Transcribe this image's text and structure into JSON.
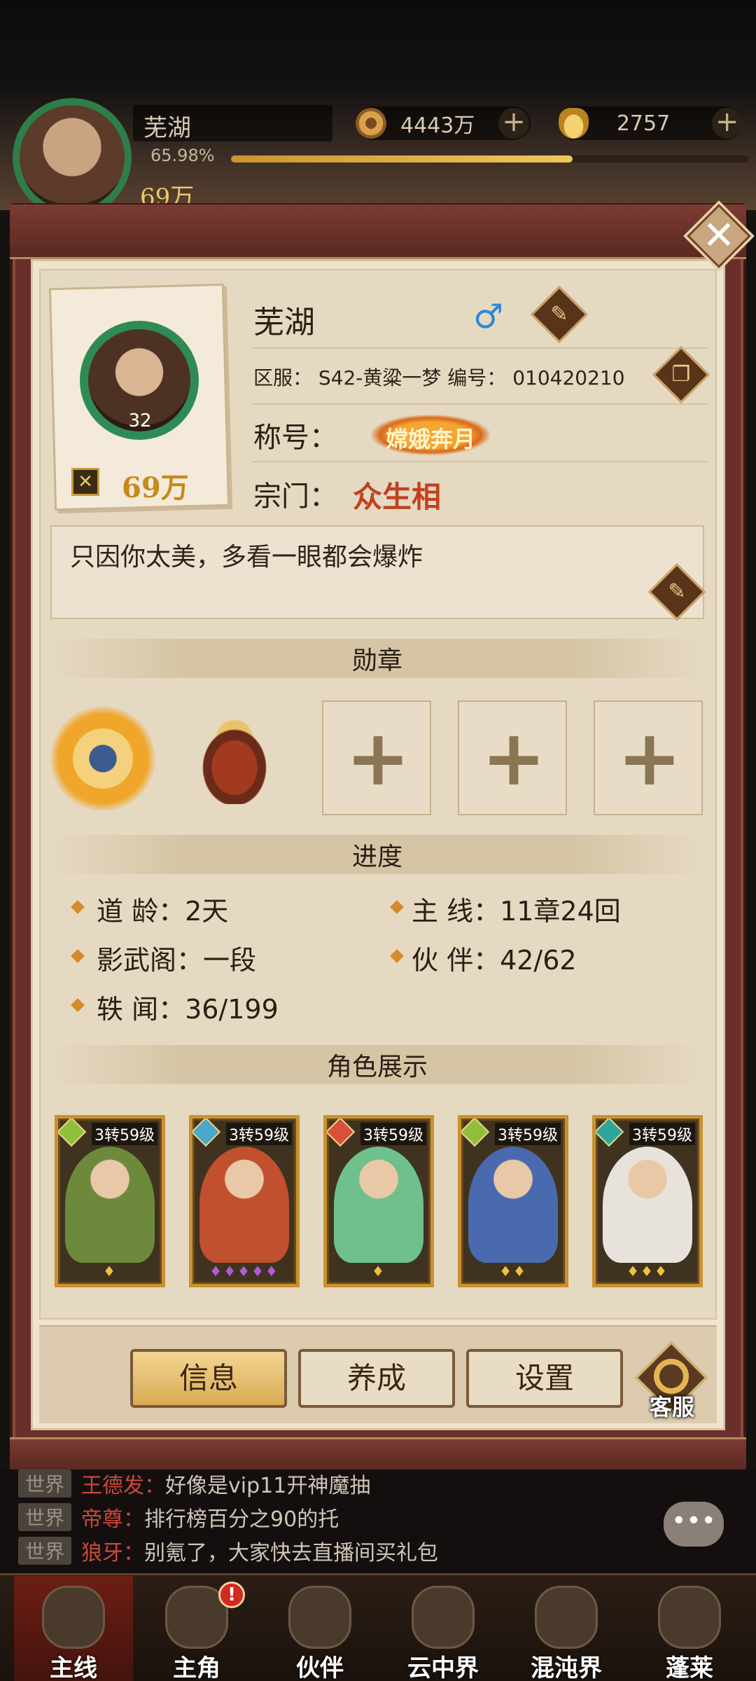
{
  "hud": {
    "name": "芜湖",
    "exp_percent_text": "65.98%",
    "exp_fraction": 0.6598,
    "power": "69万",
    "coins": "4443万",
    "ingots": "2757",
    "plus": "+"
  },
  "profile": {
    "name": "芜湖",
    "gender_symbol": "♂",
    "server": "区服：  S42-黄粱一梦 编号：  010420210",
    "title_label": "称号：",
    "title_badge": "嫦娥奔月",
    "sect_label": "宗门：",
    "sect": "众生相",
    "level": "32",
    "power": "69万",
    "signature": "只因你太美，多看一眼都会爆炸"
  },
  "sections": {
    "medals": "勋章",
    "progress": "进度",
    "characters": "角色展示"
  },
  "medal_slots": [
    "+",
    "+",
    "+"
  ],
  "progress": [
    {
      "text": "道   龄：2天"
    },
    {
      "text": "主   线：11章24回"
    },
    {
      "text": "影武阁：一段"
    },
    {
      "text": "伙   伴：42/62"
    },
    {
      "text": "轶   闻：36/199"
    }
  ],
  "characters": [
    {
      "level": "3转59级",
      "gem_color": "#8fbf3a",
      "art_color": "#6d8a3c",
      "stars": "♦",
      "star_color": "#f0c040"
    },
    {
      "level": "3转59级",
      "gem_color": "#4aa8c8",
      "art_color": "#c0502e",
      "stars": "♦♦♦♦♦",
      "star_color": "#b25ad8"
    },
    {
      "level": "3转59级",
      "gem_color": "#d8503a",
      "art_color": "#6fc08a",
      "stars": "♦",
      "star_color": "#f0c040"
    },
    {
      "level": "3转59级",
      "gem_color": "#8fbf3a",
      "art_color": "#4a6ab0",
      "stars": "♦♦",
      "star_color": "#f0c040"
    },
    {
      "level": "3转59级",
      "gem_color": "#2aa89a",
      "art_color": "#e8e2dc",
      "stars": "♦♦♦",
      "star_color": "#f0c040"
    }
  ],
  "buttons": {
    "info": "信息",
    "develop": "养成",
    "settings": "设置",
    "service": "客服"
  },
  "chat": [
    {
      "channel": "世界",
      "user": "王德发：",
      "message": "好像是vip11开神魔抽"
    },
    {
      "channel": "世界",
      "user": "帝尊：",
      "message": "排行榜百分之90的托"
    },
    {
      "channel": "世界",
      "user": "狼牙：",
      "message": "别氪了，大家快去直播间买礼包"
    }
  ],
  "chat_bubble": "•••",
  "nav": [
    {
      "label": "主线"
    },
    {
      "label": "主角"
    },
    {
      "label": "伙伴"
    },
    {
      "label": "云中界"
    },
    {
      "label": "混沌界"
    },
    {
      "label": "蓬莱"
    }
  ],
  "nav_alert": "!",
  "close_glyph": "✕"
}
